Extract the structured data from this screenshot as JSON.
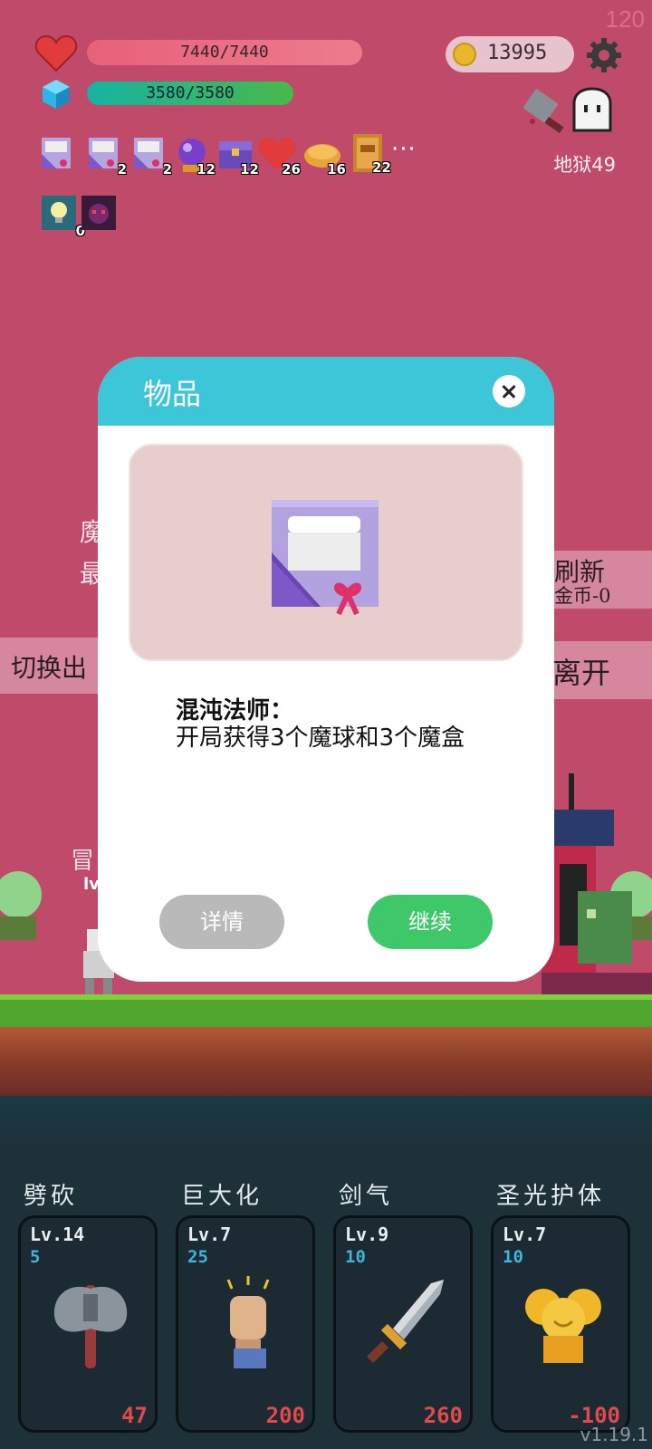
{
  "status": {
    "fps": "120",
    "hp": "7440/7440",
    "mp": "3580/3580",
    "coins": "13995",
    "location": "地狱49"
  },
  "inventory": {
    "items": [
      {
        "icon": "magic-box-icon",
        "count": ""
      },
      {
        "icon": "magic-box-icon",
        "count": "2"
      },
      {
        "icon": "magic-box-icon",
        "count": "2"
      },
      {
        "icon": "magic-orb-icon",
        "count": "12"
      },
      {
        "icon": "treasure-chest-icon",
        "count": "12"
      },
      {
        "icon": "heart-icon",
        "count": "26"
      },
      {
        "icon": "bread-icon",
        "count": "16"
      },
      {
        "icon": "spellbook-icon",
        "count": "22"
      }
    ],
    "more": "···",
    "buffs": [
      {
        "icon": "lightbulb-buff-icon",
        "count": "0"
      },
      {
        "icon": "demon-buff-icon",
        "count": ""
      }
    ]
  },
  "background_labels": {
    "left_top": "魔",
    "left_mid": "最",
    "refresh": "刷新",
    "refresh_cost": "金币-0",
    "switch": "切换出",
    "leave": "离开",
    "adventurer": "冒",
    "level": "lv"
  },
  "dialog": {
    "title": "物品",
    "item_name": "混沌法师：",
    "item_desc": "开局获得3个魔球和3个魔盒",
    "detail_button": "详情",
    "continue_button": "继续"
  },
  "skills": [
    {
      "name": "劈砍",
      "level": "Lv.14",
      "cost": "5",
      "price": "47",
      "icon": "axe-icon"
    },
    {
      "name": "巨大化",
      "level": "Lv.7",
      "cost": "25",
      "price": "200",
      "icon": "fist-icon"
    },
    {
      "name": "剑气",
      "level": "Lv.9",
      "cost": "10",
      "price": "260",
      "icon": "sword-icon"
    },
    {
      "name": "圣光护体",
      "level": "Lv.7",
      "cost": "10",
      "price": "-100",
      "icon": "holy-shield-icon"
    }
  ],
  "version": "v1.19.1",
  "colors": {
    "scene_bg": "#c04a6a",
    "dialog_header": "#3dc6d8",
    "continue": "#3ec86a",
    "detail": "#b9b9b9",
    "price_red": "#e14a4a",
    "cost_blue": "#3fb4d8"
  }
}
